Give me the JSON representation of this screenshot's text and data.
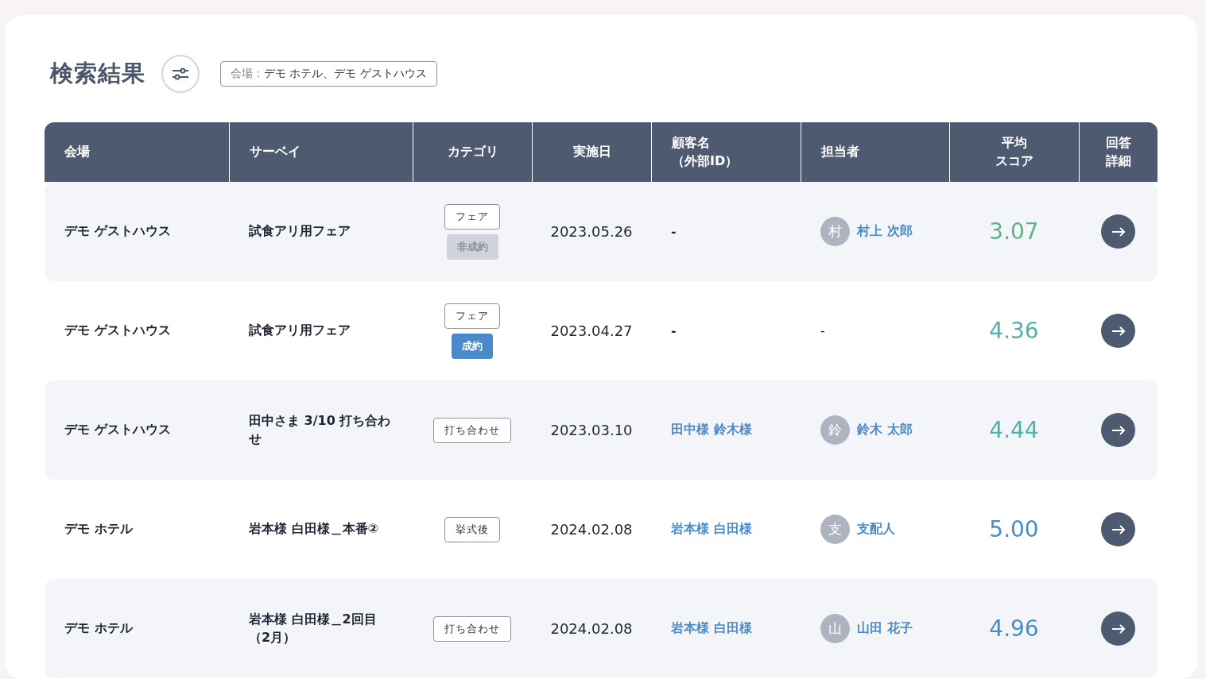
{
  "title": "検索結果",
  "filter_chip": {
    "label": "会場：",
    "value": "デモ ホテル、デモ ゲストハウス"
  },
  "table": {
    "columns": [
      {
        "lines": [
          "会場"
        ]
      },
      {
        "lines": [
          "サーベイ"
        ]
      },
      {
        "lines": [
          "カテゴリ"
        ]
      },
      {
        "lines": [
          "実施日"
        ]
      },
      {
        "lines": [
          "顧客名",
          "（外部ID）"
        ]
      },
      {
        "lines": [
          "担当者"
        ]
      },
      {
        "lines": [
          "平均",
          "スコア"
        ]
      },
      {
        "lines": [
          "回答",
          "詳細"
        ]
      }
    ],
    "rows": [
      {
        "venue": "デモ ゲストハウス",
        "survey": "試食アリ用フェア",
        "tags": [
          {
            "kind": "category",
            "label": "フェア"
          },
          {
            "kind": "lost",
            "label": "非成約"
          }
        ],
        "date": "2023.05.26",
        "customer": "-",
        "customer_link": false,
        "staff": {
          "initial": "村",
          "name": "村上 次郎"
        },
        "score": "3.07",
        "color": "#5cb585"
      },
      {
        "venue": "デモ ゲストハウス",
        "survey": "試食アリ用フェア",
        "tags": [
          {
            "kind": "category",
            "label": "フェア"
          },
          {
            "kind": "won",
            "label": "成約"
          }
        ],
        "date": "2023.04.27",
        "customer": "-",
        "customer_link": false,
        "staff": {
          "name": "-"
        },
        "score": "4.36",
        "color": "#4cb3ae"
      },
      {
        "venue": "デモ ゲストハウス",
        "survey": "田中さま 3/10 打ち合わせ",
        "tags": [
          {
            "kind": "category",
            "label": "打ち合わせ"
          }
        ],
        "date": "2023.03.10",
        "customer": "田中様 鈴木様",
        "customer_link": true,
        "staff": {
          "initial": "鈴",
          "name": "鈴木 太郎"
        },
        "score": "4.44",
        "color": "#4cb3ae"
      },
      {
        "venue": "デモ ホテル",
        "survey": "岩本様 白田様＿本番②",
        "tags": [
          {
            "kind": "category",
            "label": "挙式後"
          }
        ],
        "date": "2024.02.08",
        "customer": "岩本様 白田様",
        "customer_link": true,
        "staff": {
          "initial": "支",
          "name": "支配人"
        },
        "score": "5.00",
        "color": "#4a8bc9"
      },
      {
        "venue": "デモ ホテル",
        "survey": "岩本様 白田様＿2回目（2月）",
        "tags": [
          {
            "kind": "category",
            "label": "打ち合わせ"
          }
        ],
        "date": "2024.02.08",
        "customer": "岩本様 白田様",
        "customer_link": true,
        "staff": {
          "initial": "山",
          "name": "山田 花子"
        },
        "score": "4.96",
        "color": "#4a8bc9"
      }
    ]
  }
}
